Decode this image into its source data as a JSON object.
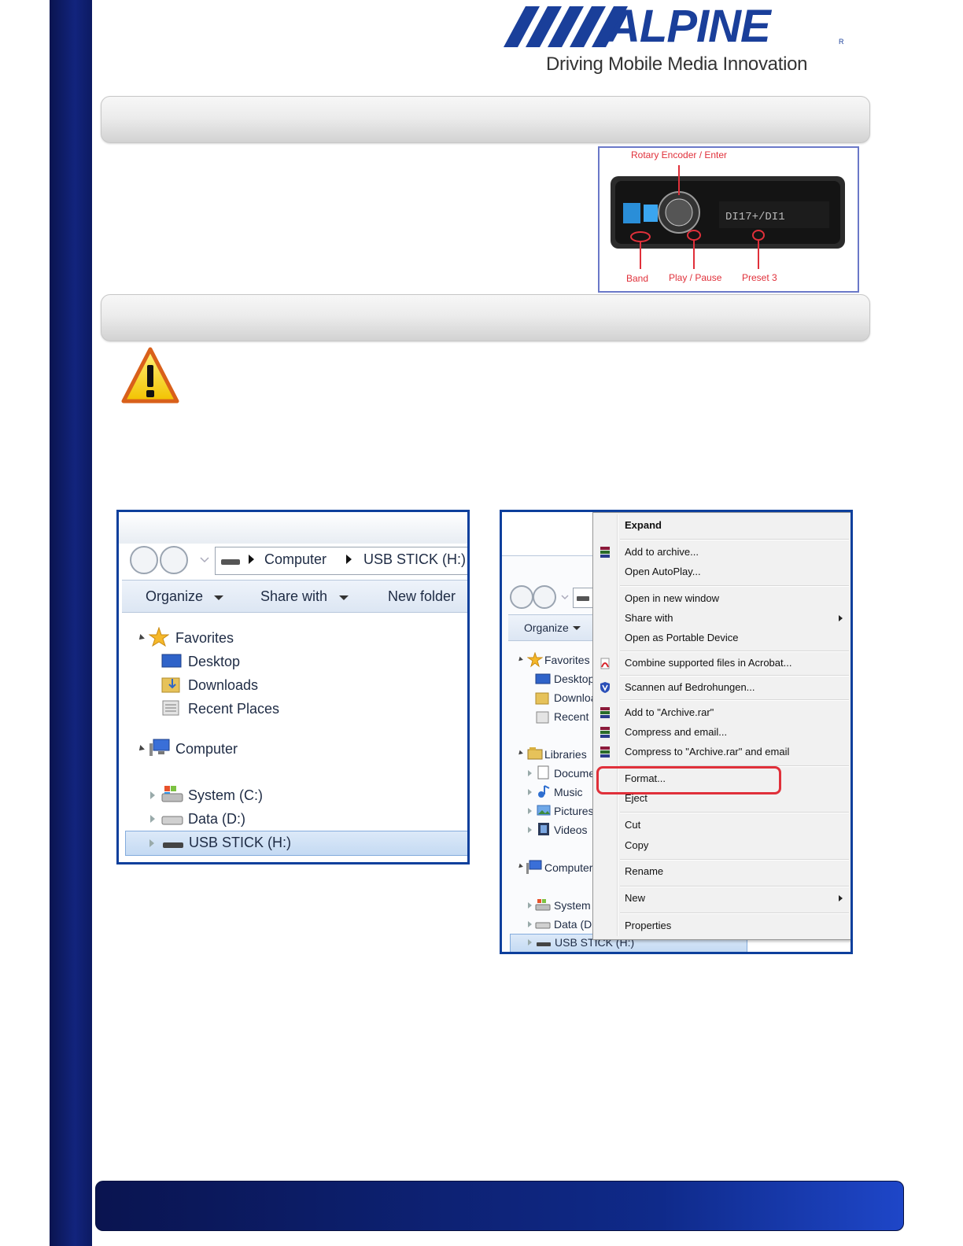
{
  "brand": {
    "logo_text": "ALPINE",
    "registered": "R",
    "tagline": "Driving Mobile Media Innovation",
    "color": "#1a3f9a"
  },
  "colors": {
    "sidebar": "#12247d",
    "frame_border": "#0d3f9c",
    "highlight_red": "#e0303a"
  },
  "radio_image": {
    "labels": {
      "top": "Rotary Encoder / Enter",
      "band": "Band",
      "play_pause": "Play / Pause",
      "preset": "Preset 3"
    }
  },
  "explorer_left": {
    "breadcrumb": [
      "Computer",
      "USB STICK (H:)"
    ],
    "toolbar": {
      "organize": "Organize",
      "share_with": "Share with",
      "new_folder": "New folder"
    },
    "favorites": {
      "label": "Favorites",
      "items": [
        "Desktop",
        "Downloads",
        "Recent Places"
      ]
    },
    "computer": {
      "label": "Computer",
      "items": [
        "System (C:)",
        "Data (D:)",
        "USB STICK (H:)"
      ]
    }
  },
  "explorer_right": {
    "toolbar": {
      "organize": "Organize"
    },
    "favorites": {
      "label": "Favorites",
      "items": [
        "Desktop",
        "Downloa",
        "Recent P"
      ]
    },
    "libraries": {
      "label": "Libraries",
      "items": [
        "Docume",
        "Music",
        "Pictures",
        "Videos"
      ]
    },
    "computer": {
      "label": "Computer",
      "items": [
        "System (",
        "Data (D:",
        "USB STICK (H:)"
      ]
    },
    "context_menu": {
      "expand": "Expand",
      "add_to_archive": "Add to archive...",
      "open_autoplay": "Open AutoPlay...",
      "open_new_window": "Open in new window",
      "share_with": "Share with",
      "open_portable": "Open as Portable Device",
      "combine_acrobat": "Combine supported files in Acrobat...",
      "scan_threats": "Scannen auf Bedrohungen...",
      "add_to_rar": "Add to \"Archive.rar\"",
      "compress_email": "Compress and email...",
      "compress_rar_email": "Compress to \"Archive.rar\" and email",
      "format": "Format...",
      "eject": "Eject",
      "cut": "Cut",
      "copy": "Copy",
      "rename": "Rename",
      "new": "New",
      "properties": "Properties"
    }
  }
}
